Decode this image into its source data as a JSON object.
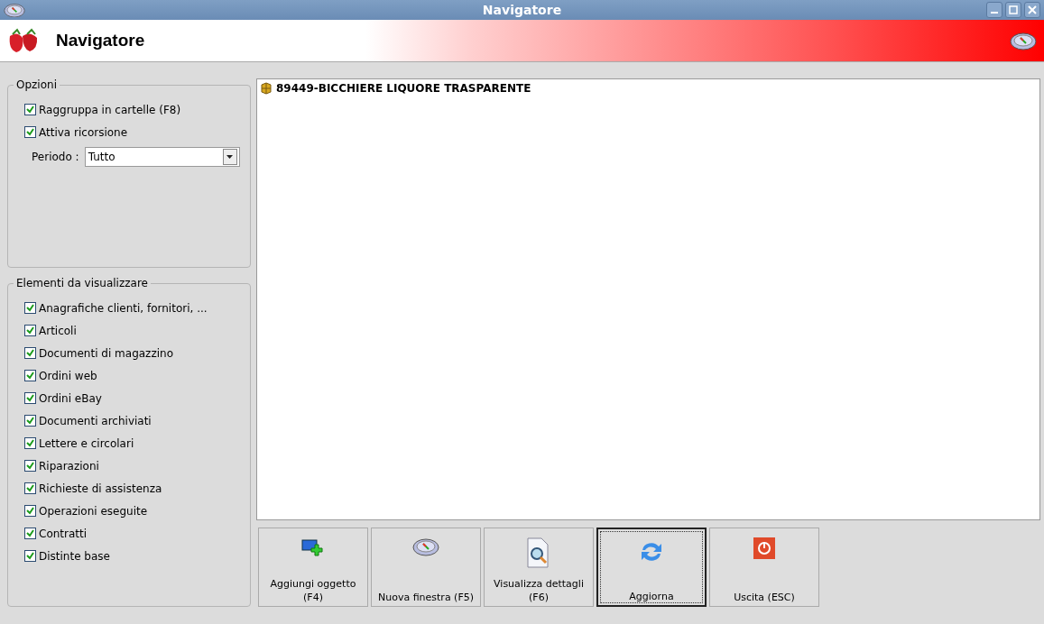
{
  "window": {
    "title": "Navigatore"
  },
  "header": {
    "title": "Navigatore"
  },
  "options": {
    "legend": "Opzioni",
    "checks": [
      {
        "label": "Raggruppa in cartelle (F8)",
        "checked": true
      },
      {
        "label": "Attiva ricorsione",
        "checked": true
      }
    ],
    "period": {
      "label": "Periodo :",
      "value": "Tutto"
    }
  },
  "elements": {
    "legend": "Elementi da visualizzare",
    "checks": [
      {
        "label": "Anagrafiche clienti, fornitori, ...",
        "checked": true
      },
      {
        "label": "Articoli",
        "checked": true
      },
      {
        "label": "Documenti di magazzino",
        "checked": true
      },
      {
        "label": "Ordini web",
        "checked": true
      },
      {
        "label": "Ordini eBay",
        "checked": true
      },
      {
        "label": "Documenti archiviati",
        "checked": true
      },
      {
        "label": "Lettere e circolari",
        "checked": true
      },
      {
        "label": "Riparazioni",
        "checked": true
      },
      {
        "label": "Richieste di assistenza",
        "checked": true
      },
      {
        "label": "Operazioni eseguite",
        "checked": true
      },
      {
        "label": "Contratti",
        "checked": true
      },
      {
        "label": "Distinte base",
        "checked": true
      }
    ]
  },
  "tree": {
    "items": [
      {
        "label": "89449-BICCHIERE LIQUORE TRASPARENTE"
      }
    ]
  },
  "buttons": [
    {
      "kind": "add",
      "label": "Aggiungi oggetto (F4)",
      "focused": false
    },
    {
      "kind": "compass",
      "label": "Nuova finestra (F5)",
      "focused": false
    },
    {
      "kind": "details",
      "label": "Visualizza dettagli (F6)",
      "focused": false
    },
    {
      "kind": "refresh",
      "label": "Aggiorna",
      "focused": true
    },
    {
      "kind": "exit",
      "label": "Uscita (ESC)",
      "focused": false
    }
  ]
}
